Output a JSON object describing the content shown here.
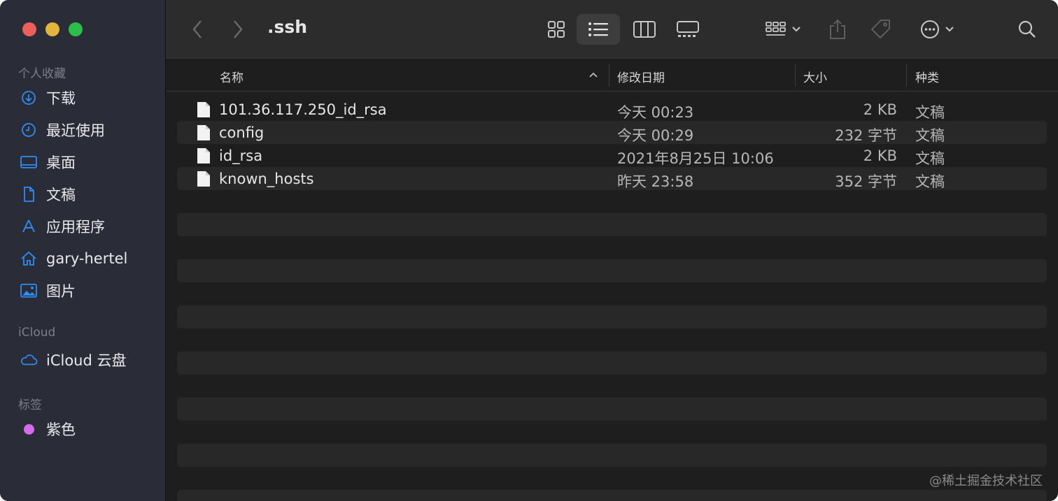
{
  "window": {
    "title": ".ssh"
  },
  "sidebar": {
    "favorites_header": "个人收藏",
    "favorites": [
      {
        "label": "下载",
        "icon": "download-icon"
      },
      {
        "label": "最近使用",
        "icon": "clock-icon"
      },
      {
        "label": "桌面",
        "icon": "desktop-icon"
      },
      {
        "label": "文稿",
        "icon": "document-icon"
      },
      {
        "label": "应用程序",
        "icon": "applications-icon"
      },
      {
        "label": "gary-hertel",
        "icon": "home-icon"
      },
      {
        "label": "图片",
        "icon": "photo-icon"
      }
    ],
    "icloud_header": "iCloud",
    "icloud": [
      {
        "label": "iCloud 云盘",
        "icon": "cloud-icon"
      }
    ],
    "tags_header": "标签",
    "tags": [
      {
        "label": "紫色",
        "color": "#d66bf0"
      }
    ]
  },
  "toolbar": {
    "back_icon": "chevron-left-icon",
    "forward_icon": "chevron-right-icon",
    "views": [
      "icon-view-icon",
      "list-view-icon",
      "column-view-icon",
      "gallery-view-icon"
    ],
    "active_view": "list-view-icon",
    "group_icon": "group-by-icon",
    "share_icon": "share-icon",
    "tag_icon": "tag-icon",
    "more_icon": "more-actions-icon",
    "search_icon": "search-icon"
  },
  "columns": {
    "name": "名称",
    "date": "修改日期",
    "size": "大小",
    "kind": "种类"
  },
  "files": [
    {
      "name": "101.36.117.250_id_rsa",
      "date": "今天 00:23",
      "size": "2 KB",
      "kind": "文稿"
    },
    {
      "name": "config",
      "date": "今天 00:29",
      "size": "232 字节",
      "kind": "文稿"
    },
    {
      "name": "id_rsa",
      "date": "2021年8月25日 10:06",
      "size": "2 KB",
      "kind": "文稿"
    },
    {
      "name": "known_hosts",
      "date": "昨天 23:58",
      "size": "352 字节",
      "kind": "文稿"
    }
  ],
  "watermark": "@稀土掘金技术社区",
  "colors": {
    "accent": "#2f8cf2",
    "sidebar_bg": "#2a2d38",
    "content_bg": "#1e1e1e"
  }
}
